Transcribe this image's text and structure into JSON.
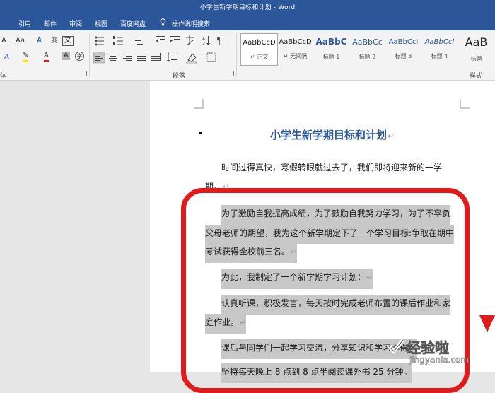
{
  "window": {
    "title": "小学生新学期目标和计划 - Word"
  },
  "tabs": [
    "引用",
    "邮件",
    "审阅",
    "视图",
    "百度网盘"
  ],
  "tell_me": "操作说明搜索",
  "ribbon": {
    "font_row1": [
      "A",
      "Aa",
      "文"
    ],
    "font_row2": [
      "A",
      "A",
      "A"
    ],
    "para_group_label": "段落",
    "styles_group_label": "样式",
    "styles": [
      {
        "sample": "AaBbCcD",
        "name": "↵ 正文"
      },
      {
        "sample": "AaBbCcD",
        "name": "↵ 无间隔"
      },
      {
        "sample": "AaBbC",
        "name": "标题 1"
      },
      {
        "sample": "AaBbCc",
        "name": "标题 2"
      },
      {
        "sample": "AaBbCcI",
        "name": "标题 3"
      },
      {
        "sample": "AaBbCcI",
        "name": "标题 4"
      },
      {
        "sample": "AaB",
        "name": "标题"
      }
    ],
    "font_group_fragment": "体"
  },
  "document": {
    "title": "小学生新学期目标和计划",
    "lines": [
      "时间过得真快，寒假转眼就过去了，我们即将迎来新的一学",
      "期。",
      "为了激励自我提高成绩，为了鼓励自我努力学习，为了不辜负",
      "父母老师的期望，我为这个新学期定下了一个学习目标:争取在期中",
      "考试获得全校前三名。",
      "为此，我制定了一个新学期学习计划：",
      "认真听课，积极发言，每天按时完成老师布置的课后作业和家",
      "庭作业。",
      "课后与同学们一起学习交流，分享知识和学习心得。",
      "坚持每天晚上 8 点到 8 点半阅读课外书 25 分钟。"
    ]
  },
  "watermark": {
    "main": "经验啦",
    "sub": "jingyanla.com"
  },
  "colors": {
    "accent": "#2b579a",
    "annotation": "#e01b1b",
    "highlight": "#c8c8c8"
  }
}
